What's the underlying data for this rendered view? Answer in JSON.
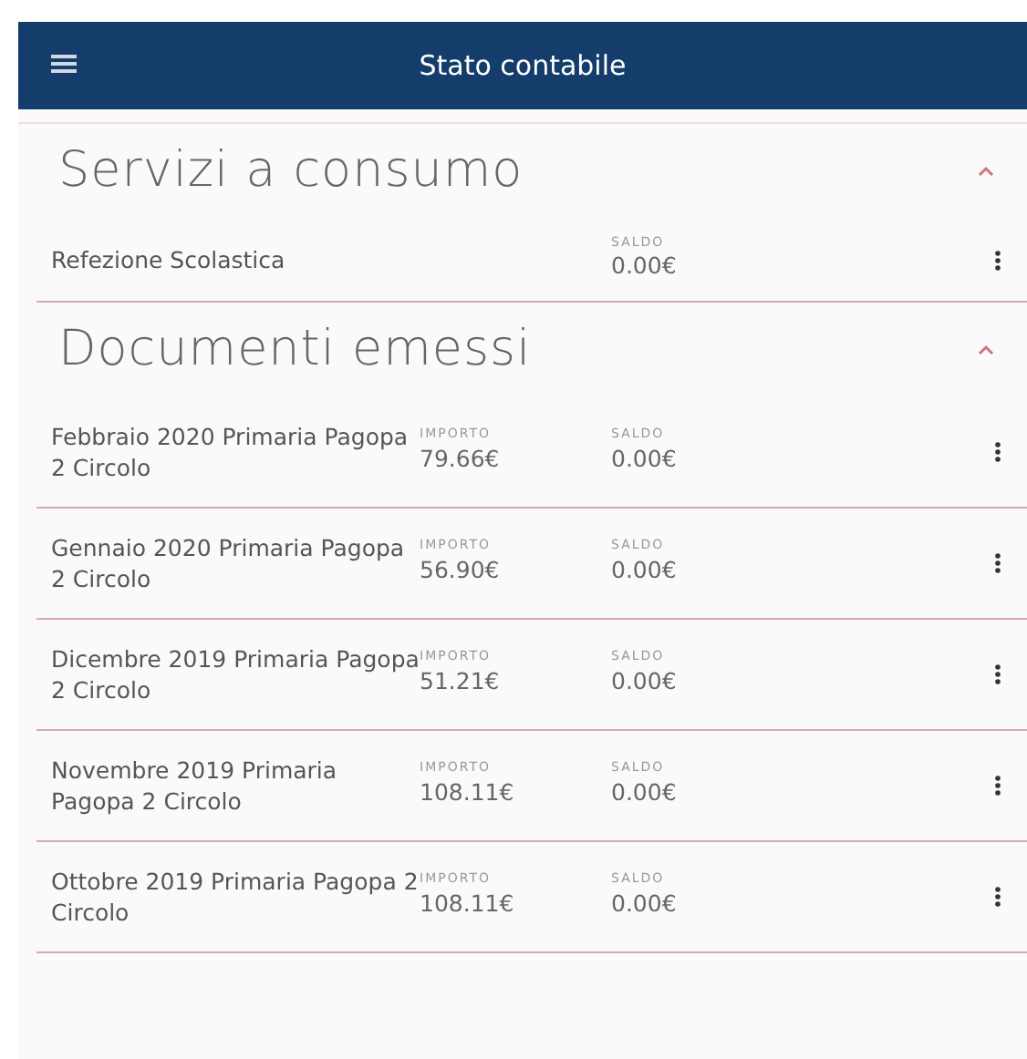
{
  "app_bar": {
    "title": "Stato contabile"
  },
  "sections": [
    {
      "title": "Servizi a consumo",
      "expanded": true,
      "rows": [
        {
          "name": "Refezione Scolastica",
          "fields": [
            {
              "kind": "blank"
            },
            {
              "kind": "value",
              "label": "SALDO",
              "value": "0.00€"
            }
          ]
        }
      ]
    },
    {
      "title": "Documenti emessi",
      "expanded": true,
      "rows": [
        {
          "name": "Febbraio 2020 Primaria Pagopa 2 Circolo",
          "fields": [
            {
              "kind": "value",
              "label": "IMPORTO",
              "value": "79.66€"
            },
            {
              "kind": "value",
              "label": "SALDO",
              "value": "0.00€"
            }
          ]
        },
        {
          "name": "Gennaio 2020 Primaria Pagopa 2 Circolo",
          "fields": [
            {
              "kind": "value",
              "label": "IMPORTO",
              "value": "56.90€"
            },
            {
              "kind": "value",
              "label": "SALDO",
              "value": "0.00€"
            }
          ]
        },
        {
          "name": "Dicembre 2019 Primaria Pagopa 2 Circolo",
          "fields": [
            {
              "kind": "value",
              "label": "IMPORTO",
              "value": "51.21€"
            },
            {
              "kind": "value",
              "label": "SALDO",
              "value": "0.00€"
            }
          ]
        },
        {
          "name": "Novembre 2019 Primaria Pagopa 2 Circolo",
          "fields": [
            {
              "kind": "value",
              "label": "IMPORTO",
              "value": "108.11€"
            },
            {
              "kind": "value",
              "label": "SALDO",
              "value": "0.00€"
            }
          ]
        },
        {
          "name": "Ottobre 2019 Primaria Pagopa 2 Circolo",
          "fields": [
            {
              "kind": "value",
              "label": "IMPORTO",
              "value": "108.11€"
            },
            {
              "kind": "value",
              "label": "SALDO",
              "value": "0.00€"
            }
          ]
        }
      ]
    }
  ]
}
